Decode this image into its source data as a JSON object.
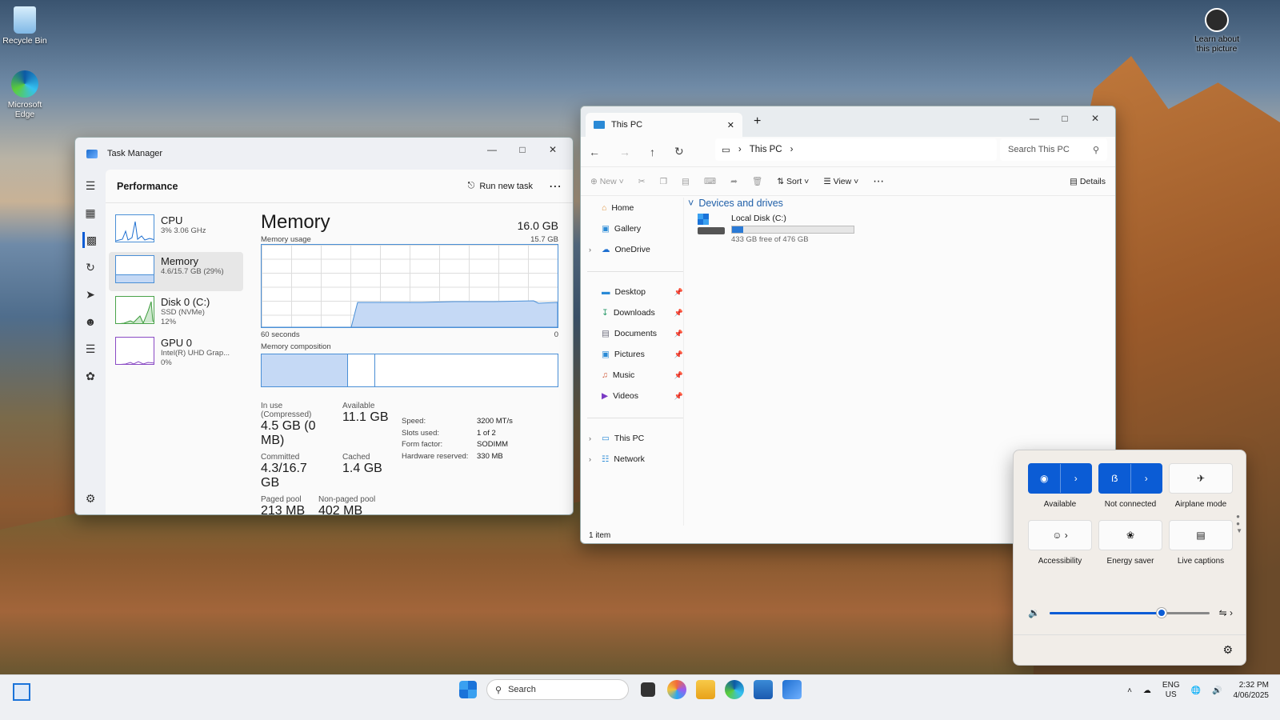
{
  "desktop": {
    "icons": [
      {
        "label": "Recycle Bin"
      },
      {
        "label": "Microsoft Edge"
      }
    ],
    "learn_label": "Learn about this picture"
  },
  "task_manager": {
    "title": "Task Manager",
    "section_title": "Performance",
    "run_new_task": "Run new task",
    "perf_items": [
      {
        "name": "CPU",
        "sub1": "3% 3.06 GHz",
        "sub2": ""
      },
      {
        "name": "Memory",
        "sub1": "4.6/15.7 GB (29%)",
        "sub2": ""
      },
      {
        "name": "Disk 0 (C:)",
        "sub1": "SSD (NVMe)",
        "sub2": "12%"
      },
      {
        "name": "GPU 0",
        "sub1": "Intel(R) UHD Grap...",
        "sub2": "0%"
      }
    ],
    "memory": {
      "title": "Memory",
      "total": "16.0 GB",
      "usage_label": "Memory usage",
      "usage_max": "15.7 GB",
      "x_left": "60 seconds",
      "x_right": "0",
      "composition_label": "Memory composition",
      "in_use_label": "In use (Compressed)",
      "in_use": "4.5 GB (0 MB)",
      "available_label": "Available",
      "available": "11.1 GB",
      "committed_label": "Committed",
      "committed": "4.3/16.7 GB",
      "cached_label": "Cached",
      "cached": "1.4 GB",
      "paged_label": "Paged pool",
      "paged": "213 MB",
      "nonpaged_label": "Non-paged pool",
      "nonpaged": "402 MB",
      "hw": [
        {
          "k": "Speed:",
          "v": "3200 MT/s"
        },
        {
          "k": "Slots used:",
          "v": "1 of 2"
        },
        {
          "k": "Form factor:",
          "v": "SODIMM"
        },
        {
          "k": "Hardware reserved:",
          "v": "330 MB"
        }
      ]
    }
  },
  "explorer": {
    "tab_title": "This PC",
    "address": "This PC",
    "search_placeholder": "Search This PC",
    "toolbar": {
      "new": "New",
      "sort": "Sort",
      "view": "View",
      "details": "Details"
    },
    "sidebar": [
      {
        "label": "Home"
      },
      {
        "label": "Gallery"
      },
      {
        "label": "OneDrive"
      },
      {
        "label": "Desktop"
      },
      {
        "label": "Downloads"
      },
      {
        "label": "Documents"
      },
      {
        "label": "Pictures"
      },
      {
        "label": "Music"
      },
      {
        "label": "Videos"
      },
      {
        "label": "This PC"
      },
      {
        "label": "Network"
      }
    ],
    "group": "Devices and drives",
    "drive": {
      "name": "Local Disk (C:)",
      "free": "433 GB free of 476 GB",
      "used_fraction": 0.09
    },
    "status": "1 item"
  },
  "quick_settings": {
    "tiles": [
      {
        "label": "Available"
      },
      {
        "label": "Not connected"
      },
      {
        "label": "Airplane mode"
      },
      {
        "label": "Accessibility"
      },
      {
        "label": "Energy saver"
      },
      {
        "label": "Live captions"
      }
    ],
    "volume": 0.7
  },
  "taskbar": {
    "search_label": "Search",
    "lang": "ENG",
    "region": "US",
    "time": "2:32 PM",
    "date": "4/06/2025"
  }
}
